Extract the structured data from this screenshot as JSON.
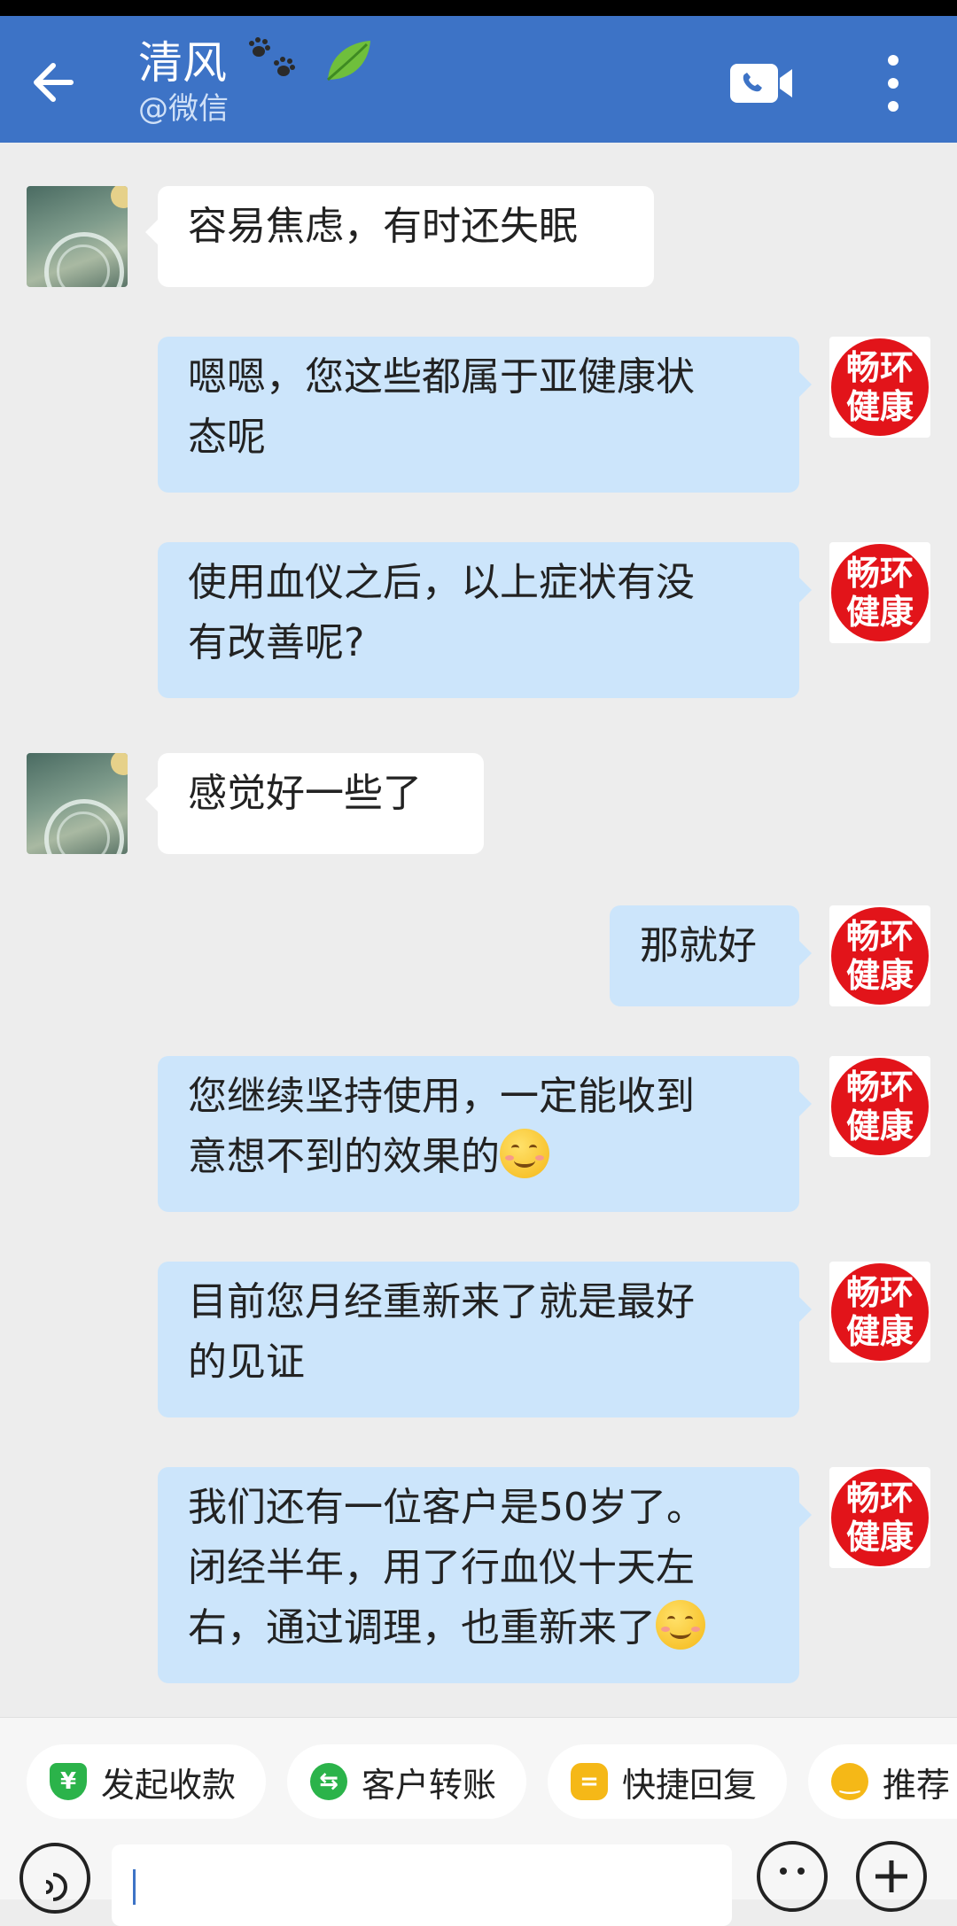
{
  "header": {
    "title": "清风",
    "subtitle": "@微信",
    "title_emoji": [
      "paw-prints-icon",
      "leaf-icon"
    ],
    "background_color": "#3d73c6"
  },
  "contact_avatar": {
    "icon": "moon-landscape-avatar"
  },
  "self_avatar": {
    "line1": "畅环",
    "line2": "健康",
    "color": "#e2141a"
  },
  "messages": [
    {
      "side": "left",
      "text": "容易焦虑，有时还失眠"
    },
    {
      "side": "right",
      "line1": "嗯嗯，您这些都属于亚健康状",
      "line2": "态呢"
    },
    {
      "side": "right",
      "line1": "使用血仪之后，以上症状有没",
      "line2": "有改善呢?"
    },
    {
      "side": "left",
      "text": "感觉好一些了"
    },
    {
      "side": "right",
      "text": "那就好"
    },
    {
      "side": "right",
      "line1": "您继续坚持使用，一定能收到",
      "line2": "意想不到的效果的",
      "emoji": "smiling-face-icon"
    },
    {
      "side": "right",
      "line1": "目前您月经重新来了就是最好",
      "line2": "的见证"
    },
    {
      "side": "right",
      "line1": "我们还有一位客户是50岁了。",
      "line2": "闭经半年，用了行血仪十天左",
      "line3": "右，通过调理，也重新来了",
      "emoji": "smiling-face-icon"
    }
  ],
  "quick_actions": [
    {
      "label": "发起收款",
      "icon": "yuan-shield-icon",
      "color": "#2bb34a"
    },
    {
      "label": "客户转账",
      "icon": "transfer-icon",
      "color": "#2bb34a"
    },
    {
      "label": "快捷回复",
      "icon": "quick-reply-icon",
      "color": "#f5b817"
    },
    {
      "label": "推荐",
      "icon": "recommend-icon",
      "color": "#f5b817"
    }
  ],
  "input": {
    "placeholder": ""
  }
}
